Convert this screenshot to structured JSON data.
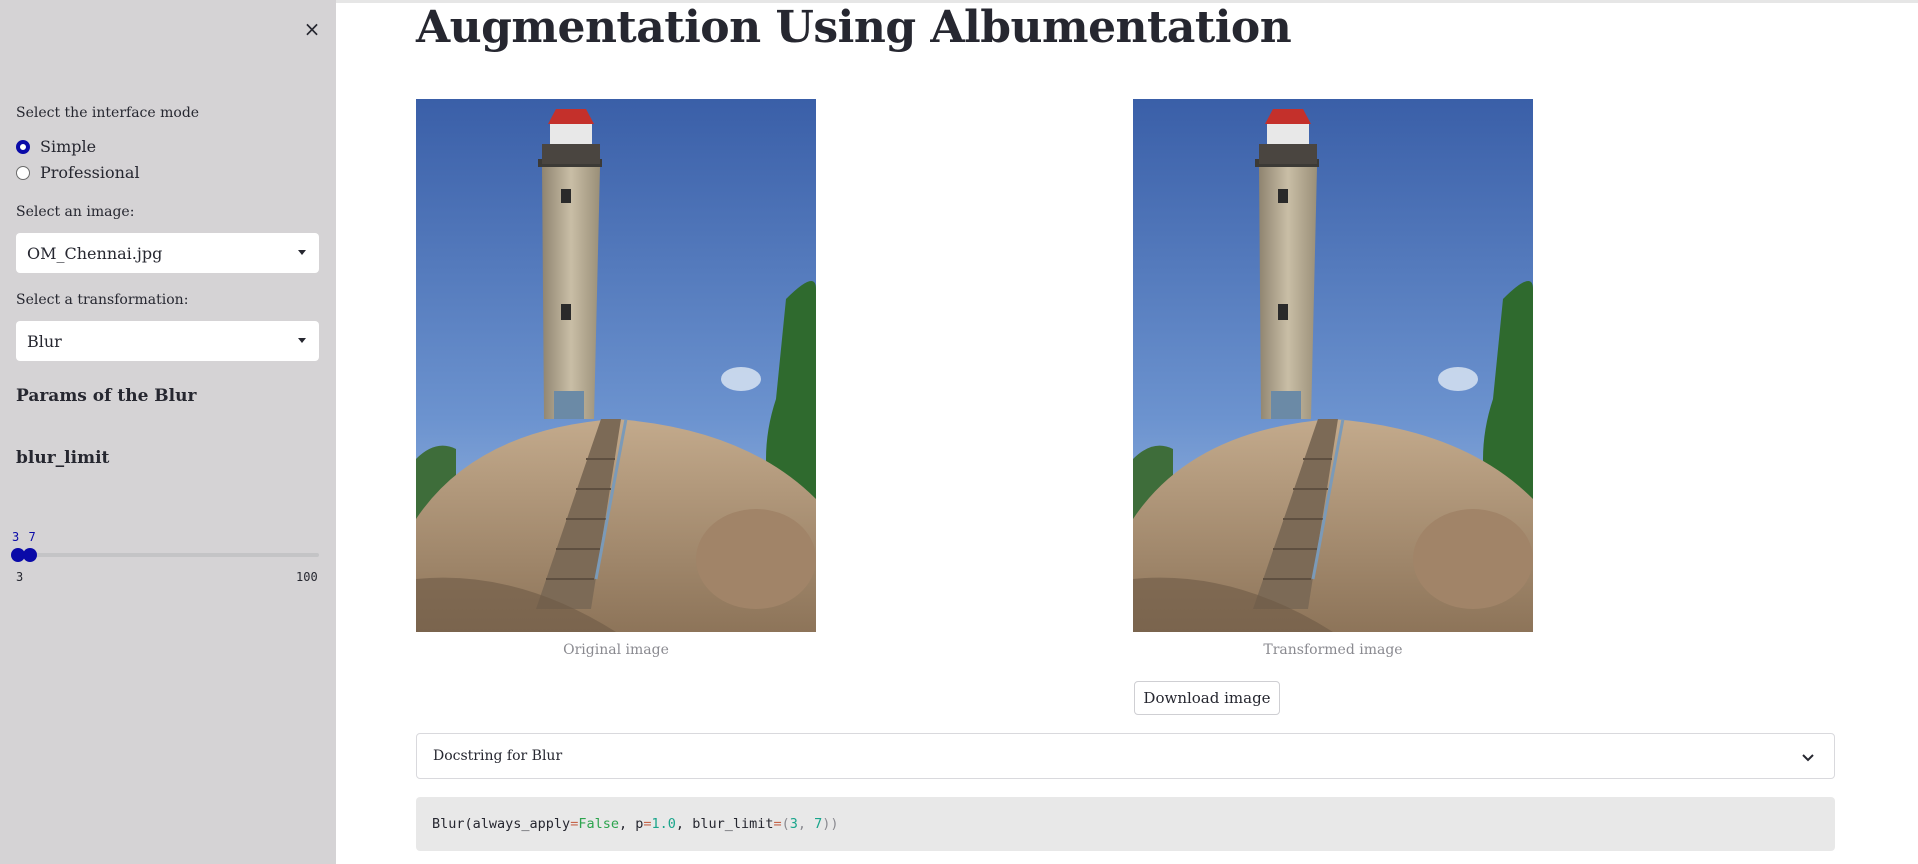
{
  "sidebar": {
    "close_icon": "×",
    "mode_label": "Select the interface mode",
    "modes": [
      {
        "label": "Simple",
        "selected": true
      },
      {
        "label": "Professional",
        "selected": false
      }
    ],
    "image_label": "Select an image:",
    "image_value": "OM_Chennai.jpg",
    "transform_label": "Select a transformation:",
    "transform_value": "Blur",
    "params_heading": "Params of the Blur",
    "param_name": "blur_limit",
    "slider": {
      "values_text": "3 7",
      "low": 3,
      "high": 7,
      "min": 3,
      "max": 100,
      "min_label": "3",
      "max_label": "100"
    }
  },
  "main": {
    "title": "Augmentation Using Albumentation",
    "original_caption": "Original image",
    "transformed_caption": "Transformed image",
    "download_label": "Download image",
    "expander_label": "Docstring for Blur",
    "code": {
      "fn": "Blur",
      "open": "(",
      "arg1": "always_apply",
      "eq": "=",
      "v1": "False",
      "sep": ", ",
      "arg2": "p",
      "v2": "1.0",
      "arg3": "blur_limit",
      "v3_open": "(",
      "v3_a": "3",
      "v3_sep": ", ",
      "v3_b": "7",
      "v3_close": "))"
    }
  },
  "colors": {
    "accent": "#0a0aa8",
    "sidebar_bg": "#d5d3d5",
    "code_bg": "#e8e8e8"
  }
}
